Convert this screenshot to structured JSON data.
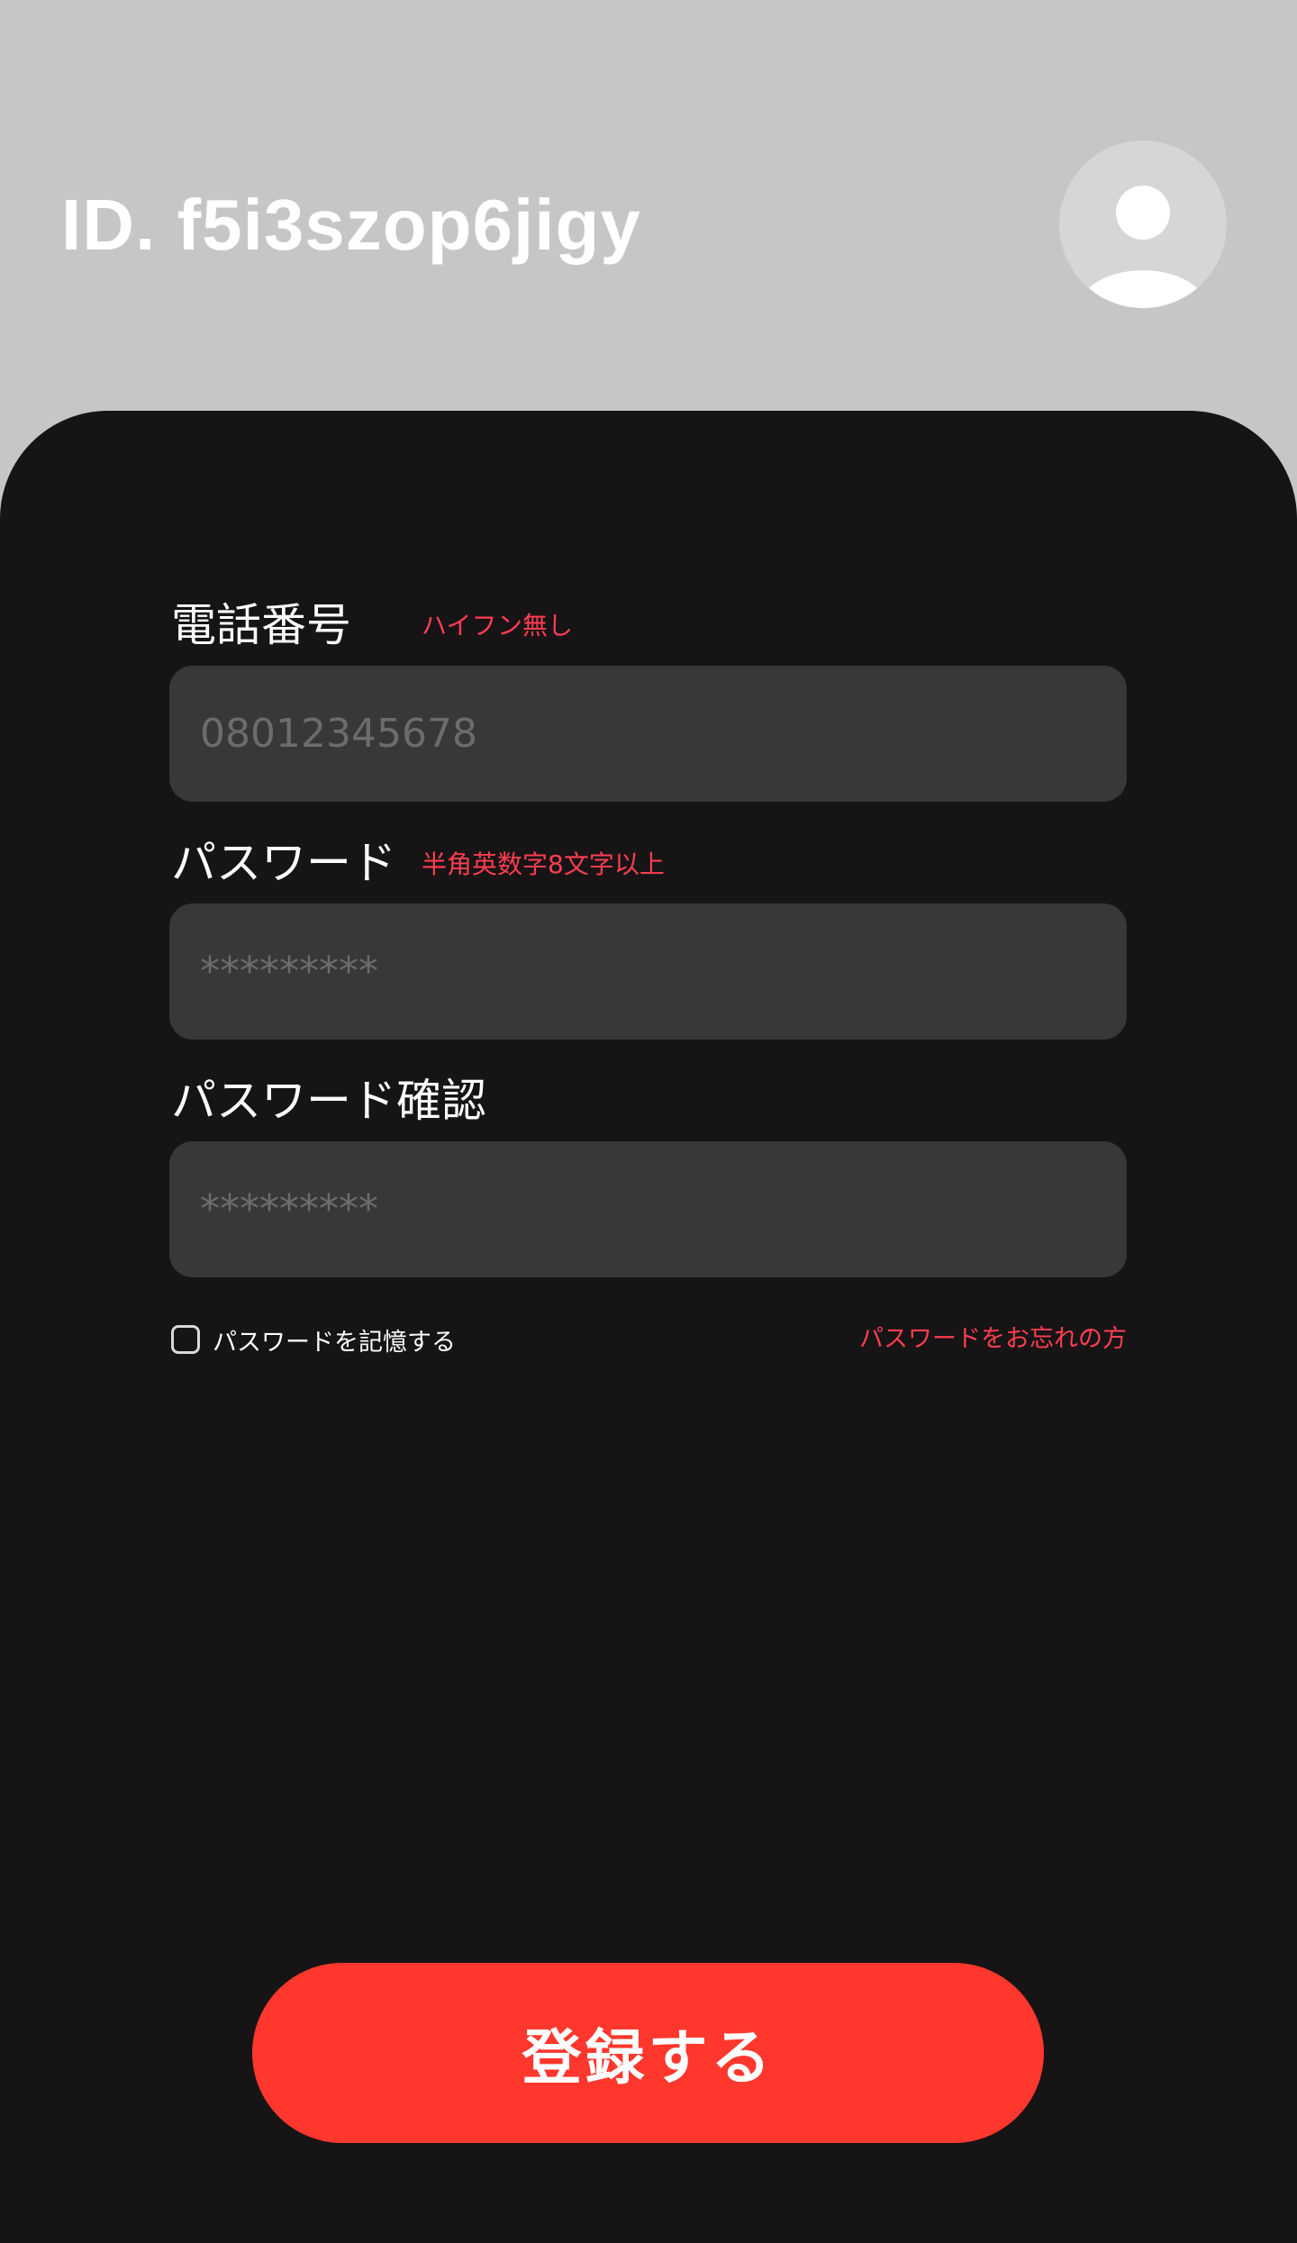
{
  "header": {
    "user_id": "ID. f5i3szop6jigy",
    "avatar_icon": "user-avatar-icon"
  },
  "form": {
    "phone": {
      "label": "電話番号",
      "hint": "ハイフン無し",
      "placeholder": "08012345678",
      "value": ""
    },
    "password": {
      "label": "パスワード",
      "hint": "半角英数字8文字以上",
      "placeholder": "*********",
      "value": ""
    },
    "password_confirm": {
      "label": "パスワード確認",
      "placeholder": "*********",
      "value": ""
    },
    "remember": {
      "label": "パスワードを記憶する",
      "checked": false
    },
    "forgot_link": "パスワードをお忘れの方",
    "submit_label": "登録する"
  },
  "colors": {
    "header_bg": "#c6c6c6",
    "panel_bg": "#161415",
    "field_bg": "#39373a",
    "accent_red": "#ff372d",
    "hint_red": "#ff3d52"
  }
}
